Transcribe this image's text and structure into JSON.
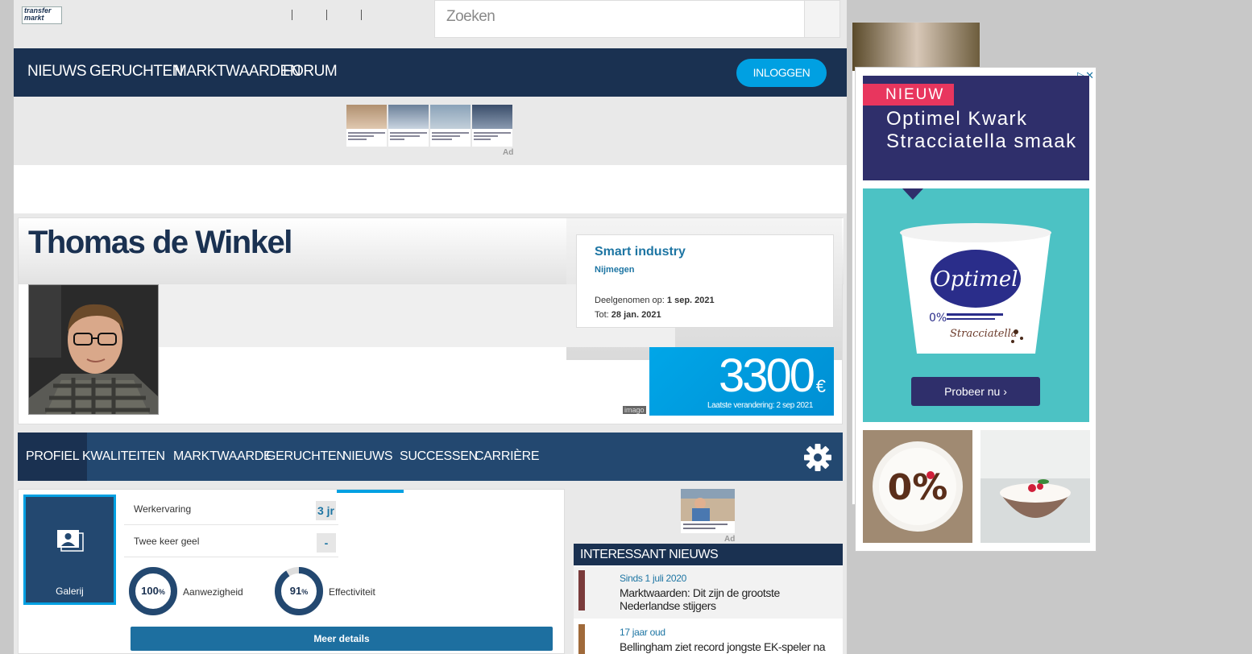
{
  "site": {
    "logo_line1": "transfer",
    "logo_line2": "markt"
  },
  "search": {
    "placeholder": "Zoeken"
  },
  "nav": {
    "items": [
      {
        "label": "NIEUWS"
      },
      {
        "label": "GERUCHTEN"
      },
      {
        "label": "MARKTWAARDEN"
      },
      {
        "label": "FORUM"
      }
    ],
    "login_label": "INLOGGEN"
  },
  "ads": {
    "label": "Ad"
  },
  "player": {
    "first_name": "Thomas",
    "last_name": "de Winkel",
    "club": "Smart industry",
    "city": "Nijmegen",
    "joined_label": "Deelgenomen op:",
    "joined_value": "1 sep. 2021",
    "until_label": "Tot:",
    "until_value": "28 jan. 2021",
    "market_value": "3300",
    "currency": "€",
    "last_change": "Laatste verandering: 2 sep 2021",
    "photo_credit": "imago"
  },
  "tabs": [
    {
      "label": "PROFIEL",
      "active": true
    },
    {
      "label": "KWALITEITEN",
      "active": false
    },
    {
      "label": "MARKTWAARDE",
      "active": false
    },
    {
      "label": "GERUCHTEN",
      "active": false
    },
    {
      "label": "NIEUWS",
      "active": false
    },
    {
      "label": "SUCCESSEN",
      "active": false
    },
    {
      "label": "CARRIÈRE",
      "active": false
    }
  ],
  "profile": {
    "gallery_label": "Galerij",
    "stats": [
      {
        "label": "Werkervaring",
        "value": "3 jr"
      },
      {
        "label": "Twee keer geel",
        "value": "-"
      }
    ],
    "rings": [
      {
        "value": "100",
        "unit": "%",
        "label": "Aanwezigheid",
        "fraction": 1.0
      },
      {
        "value": "91",
        "unit": "%",
        "label": "Effectiviteit",
        "fraction": 0.91
      }
    ],
    "details_button": "Meer details"
  },
  "news": {
    "heading": "INTERESSANT NIEUWS",
    "items": [
      {
        "date": "Sinds 1 juli 2020",
        "title": "Marktwaarden: Dit zijn de grootste Nederlandse stijgers"
      },
      {
        "date": "17 jaar oud",
        "title": "Bellingham ziet record jongste EK-speler na een paar"
      }
    ]
  },
  "advert": {
    "badge": "NIEUW",
    "headline": "Optimel Kwark Stracciatella smaak",
    "cta": "Probeer nu",
    "brand": "Optimel",
    "colors": {
      "navy": "#2f2f6b",
      "pink": "#e8365e",
      "teal": "#4cc2c4"
    }
  },
  "colors": {
    "nav": "#1a3151",
    "subnav": "#234870",
    "accent": "#00a0e2",
    "link": "#1d75a3"
  }
}
